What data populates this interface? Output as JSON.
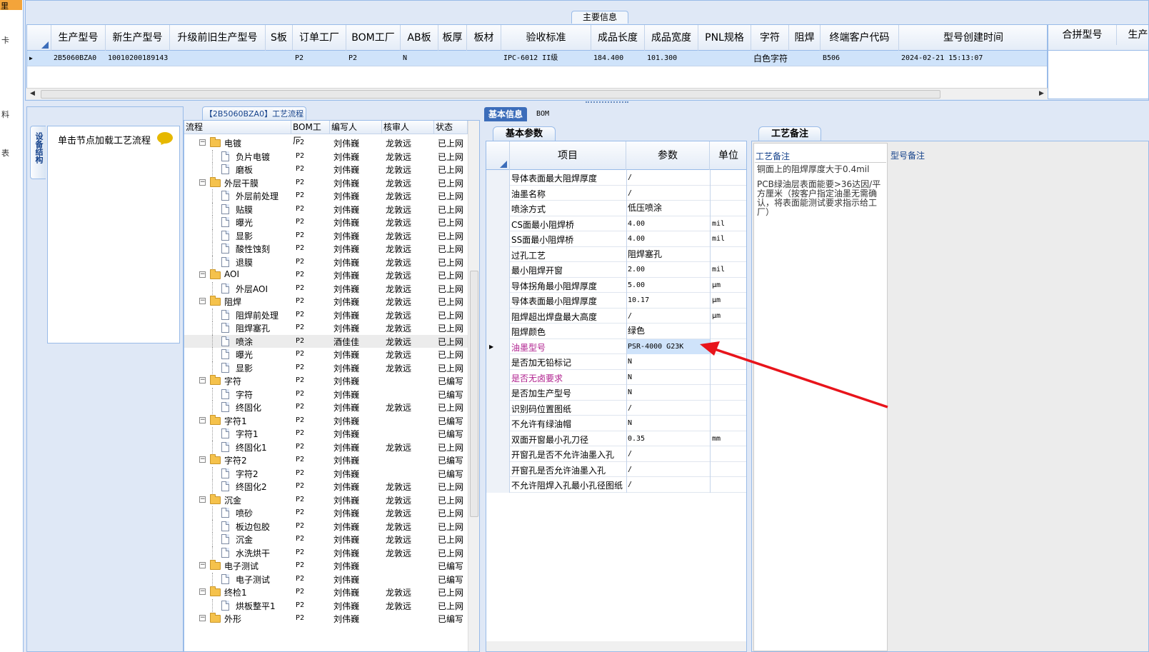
{
  "left_strip": {
    "top_label": "里",
    "chars": [
      "卡",
      "料",
      "表"
    ]
  },
  "main_info": {
    "tab_label": "主要信息",
    "columns": [
      "生产型号",
      "新生产型号",
      "升级前旧生产型号",
      "S板",
      "订单工厂",
      "BOM工厂",
      "AB板",
      "板厚",
      "板材",
      "验收标准",
      "成品长度",
      "成品宽度",
      "PNL规格",
      "字符",
      "阻焊",
      "终端客户代码",
      "型号创建时间"
    ],
    "row": {
      "prod_model": "2B5060BZA0",
      "new_prod_model": "10010200189143",
      "old_model": "",
      "s_board": "",
      "order_factory": "P2",
      "bom_factory": "P2",
      "ab_board": "N",
      "thickness": "",
      "material": "",
      "standard": "IPC-6012 II级",
      "length": "184.400",
      "width": "101.300",
      "pnl": "",
      "char": "白色字符",
      "mask": "",
      "customer_code": "B506",
      "created": "2024-02-21 15:13:07"
    },
    "right_columns": [
      "合拼型号",
      "生产"
    ]
  },
  "left_panel": {
    "vertical_tab": "设备结构",
    "hint": "单击节点加载工艺流程"
  },
  "process": {
    "tab_label": "【2B5060BZA0】工艺流程",
    "headers": [
      "流程",
      "BOM工厂",
      "编写人",
      "核审人",
      "状态"
    ],
    "rows": [
      {
        "name": "电镀",
        "lvl": 0,
        "factory": "P2",
        "author": "刘伟巍",
        "reviewer": "龙敦远",
        "status": "已上网"
      },
      {
        "name": "负片电镀",
        "lvl": 1,
        "factory": "P2",
        "author": "刘伟巍",
        "reviewer": "龙敦远",
        "status": "已上网"
      },
      {
        "name": "磨板",
        "lvl": 1,
        "factory": "P2",
        "author": "刘伟巍",
        "reviewer": "龙敦远",
        "status": "已上网"
      },
      {
        "name": "外层干膜",
        "lvl": 0,
        "factory": "P2",
        "author": "刘伟巍",
        "reviewer": "龙敦远",
        "status": "已上网"
      },
      {
        "name": "外层前处理",
        "lvl": 1,
        "factory": "P2",
        "author": "刘伟巍",
        "reviewer": "龙敦远",
        "status": "已上网"
      },
      {
        "name": "贴膜",
        "lvl": 1,
        "factory": "P2",
        "author": "刘伟巍",
        "reviewer": "龙敦远",
        "status": "已上网"
      },
      {
        "name": "曝光",
        "lvl": 1,
        "factory": "P2",
        "author": "刘伟巍",
        "reviewer": "龙敦远",
        "status": "已上网"
      },
      {
        "name": "显影",
        "lvl": 1,
        "factory": "P2",
        "author": "刘伟巍",
        "reviewer": "龙敦远",
        "status": "已上网"
      },
      {
        "name": "酸性蚀刻",
        "lvl": 1,
        "factory": "P2",
        "author": "刘伟巍",
        "reviewer": "龙敦远",
        "status": "已上网"
      },
      {
        "name": "退膜",
        "lvl": 1,
        "factory": "P2",
        "author": "刘伟巍",
        "reviewer": "龙敦远",
        "status": "已上网"
      },
      {
        "name": "AOI",
        "lvl": 0,
        "factory": "P2",
        "author": "刘伟巍",
        "reviewer": "龙敦远",
        "status": "已上网"
      },
      {
        "name": "外层AOI",
        "lvl": 1,
        "factory": "P2",
        "author": "刘伟巍",
        "reviewer": "龙敦远",
        "status": "已上网"
      },
      {
        "name": "阻焊",
        "lvl": 0,
        "factory": "P2",
        "author": "刘伟巍",
        "reviewer": "龙敦远",
        "status": "已上网"
      },
      {
        "name": "阻焊前处理",
        "lvl": 1,
        "factory": "P2",
        "author": "刘伟巍",
        "reviewer": "龙敦远",
        "status": "已上网"
      },
      {
        "name": "阻焊塞孔",
        "lvl": 1,
        "factory": "P2",
        "author": "刘伟巍",
        "reviewer": "龙敦远",
        "status": "已上网"
      },
      {
        "name": "喷涂",
        "lvl": 1,
        "factory": "P2",
        "author": "酒佳佳",
        "reviewer": "龙敦远",
        "status": "已上网",
        "selected": true
      },
      {
        "name": "曝光",
        "lvl": 1,
        "factory": "P2",
        "author": "刘伟巍",
        "reviewer": "龙敦远",
        "status": "已上网"
      },
      {
        "name": "显影",
        "lvl": 1,
        "factory": "P2",
        "author": "刘伟巍",
        "reviewer": "龙敦远",
        "status": "已上网"
      },
      {
        "name": "字符",
        "lvl": 0,
        "factory": "P2",
        "author": "刘伟巍",
        "reviewer": "",
        "status": "已编写"
      },
      {
        "name": "字符",
        "lvl": 1,
        "factory": "P2",
        "author": "刘伟巍",
        "reviewer": "",
        "status": "已编写"
      },
      {
        "name": "终固化",
        "lvl": 1,
        "factory": "P2",
        "author": "刘伟巍",
        "reviewer": "龙敦远",
        "status": "已上网"
      },
      {
        "name": "字符1",
        "lvl": 0,
        "factory": "P2",
        "author": "刘伟巍",
        "reviewer": "",
        "status": "已编写"
      },
      {
        "name": "字符1",
        "lvl": 1,
        "factory": "P2",
        "author": "刘伟巍",
        "reviewer": "",
        "status": "已编写"
      },
      {
        "name": "终固化1",
        "lvl": 1,
        "factory": "P2",
        "author": "刘伟巍",
        "reviewer": "龙敦远",
        "status": "已上网"
      },
      {
        "name": "字符2",
        "lvl": 0,
        "factory": "P2",
        "author": "刘伟巍",
        "reviewer": "",
        "status": "已编写"
      },
      {
        "name": "字符2",
        "lvl": 1,
        "factory": "P2",
        "author": "刘伟巍",
        "reviewer": "",
        "status": "已编写"
      },
      {
        "name": "终固化2",
        "lvl": 1,
        "factory": "P2",
        "author": "刘伟巍",
        "reviewer": "龙敦远",
        "status": "已上网"
      },
      {
        "name": "沉金",
        "lvl": 0,
        "factory": "P2",
        "author": "刘伟巍",
        "reviewer": "龙敦远",
        "status": "已上网"
      },
      {
        "name": "喷砂",
        "lvl": 1,
        "factory": "P2",
        "author": "刘伟巍",
        "reviewer": "龙敦远",
        "status": "已上网"
      },
      {
        "name": "板边包胶",
        "lvl": 1,
        "factory": "P2",
        "author": "刘伟巍",
        "reviewer": "龙敦远",
        "status": "已上网"
      },
      {
        "name": "沉金",
        "lvl": 1,
        "factory": "P2",
        "author": "刘伟巍",
        "reviewer": "龙敦远",
        "status": "已上网"
      },
      {
        "name": "水洗烘干",
        "lvl": 1,
        "factory": "P2",
        "author": "刘伟巍",
        "reviewer": "龙敦远",
        "status": "已上网"
      },
      {
        "name": "电子测试",
        "lvl": 0,
        "factory": "P2",
        "author": "刘伟巍",
        "reviewer": "",
        "status": "已编写"
      },
      {
        "name": "电子测试",
        "lvl": 1,
        "factory": "P2",
        "author": "刘伟巍",
        "reviewer": "",
        "status": "已编写"
      },
      {
        "name": "终检1",
        "lvl": 0,
        "factory": "P2",
        "author": "刘伟巍",
        "reviewer": "龙敦远",
        "status": "已上网"
      },
      {
        "name": "烘板整平1",
        "lvl": 1,
        "factory": "P2",
        "author": "刘伟巍",
        "reviewer": "龙敦远",
        "status": "已上网"
      },
      {
        "name": "外形",
        "lvl": 0,
        "factory": "P2",
        "author": "刘伟巍",
        "reviewer": "",
        "status": "已编写"
      }
    ]
  },
  "tabs": {
    "basic": "基本信息",
    "bom": "BOM"
  },
  "basic_params": {
    "tab_label": "基本参数",
    "headers": [
      "项目",
      "参数",
      "单位"
    ],
    "rows": [
      {
        "item": "导体表面最大阻焊厚度",
        "value": "/",
        "unit": ""
      },
      {
        "item": "油墨名称",
        "value": "/",
        "unit": ""
      },
      {
        "item": "喷涂方式",
        "value": "低压喷涂",
        "unit": ""
      },
      {
        "item": "CS面最小阻焊桥",
        "value": "4.00",
        "unit": "mil"
      },
      {
        "item": "SS面最小阻焊桥",
        "value": "4.00",
        "unit": "mil"
      },
      {
        "item": "过孔工艺",
        "value": "阻焊塞孔",
        "unit": ""
      },
      {
        "item": "最小阻焊开窗",
        "value": "2.00",
        "unit": "mil"
      },
      {
        "item": "导体拐角最小阻焊厚度",
        "value": "5.00",
        "unit": "μm"
      },
      {
        "item": "导体表面最小阻焊厚度",
        "value": "10.17",
        "unit": "μm"
      },
      {
        "item": "阻焊超出焊盘最大高度",
        "value": "/",
        "unit": "μm"
      },
      {
        "item": "阻焊颜色",
        "value": "绿色",
        "unit": ""
      },
      {
        "item": "油墨型号",
        "value": "PSR-4000 G23K",
        "unit": "",
        "pink": true,
        "highlight": true,
        "current": true
      },
      {
        "item": "是否加无铅标记",
        "value": "N",
        "unit": ""
      },
      {
        "item": "是否无卤要求",
        "value": "N",
        "unit": "",
        "pink": true
      },
      {
        "item": "是否加生产型号",
        "value": "N",
        "unit": ""
      },
      {
        "item": "识别码位置图纸",
        "value": "/",
        "unit": ""
      },
      {
        "item": "不允许有绿油帽",
        "value": "N",
        "unit": ""
      },
      {
        "item": "双面开窗最小孔刀径",
        "value": "0.35",
        "unit": "mm"
      },
      {
        "item": "开窗孔是否不允许油墨入孔",
        "value": "/",
        "unit": ""
      },
      {
        "item": "开窗孔是否允许油墨入孔",
        "value": "/",
        "unit": ""
      },
      {
        "item": "不允许阻焊入孔最小孔径图纸",
        "value": "/",
        "unit": ""
      }
    ]
  },
  "notes": {
    "tab_label": "工艺备注",
    "process_label": "工艺备注",
    "model_label": "型号备注",
    "process_text_1": "铜面上的阻焊厚度大于0.4mil",
    "process_text_2": "PCB绿油层表面能要>36达因/平方厘米（按客户指定油墨无需确认，将表面能测试要求指示给工厂）"
  },
  "colors": {
    "accent": "#3c6dba",
    "selected_row": "#cfe3fa",
    "pink_text": "#b0218f",
    "arrow": "#e8141b"
  }
}
